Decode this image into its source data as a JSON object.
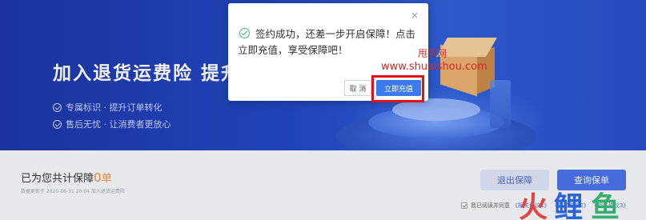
{
  "banner": {
    "title": "加入退货运费险 提升店",
    "features": [
      "专属标识 · 提升订单转化",
      "售后无忧 · 让消费者更放心"
    ]
  },
  "summary": {
    "prefix": "已为您共计保障",
    "count": "0",
    "unit": "单",
    "subtext": "数据更新于 2020-06-31 20:04 加入退货运费险"
  },
  "actions": {
    "exit_label": "退出保障",
    "query_label": "查询保单"
  },
  "agreement": {
    "label": "我已阅读并同意",
    "links": [
      "《相关协议1》",
      "《相关协议2》",
      "《相关协议3》"
    ]
  },
  "dialog": {
    "close_glyph": "×",
    "message": "签约成功，还差一步开启保障！点击立即充值，享受保障吧！",
    "cancel_label": "取 消",
    "recharge_label": "立即充值"
  },
  "watermark": {
    "site_name": "甩手网",
    "site_url": "www.shuaishou.com",
    "logo_chars": [
      "火",
      "鲤",
      "鱼"
    ]
  },
  "colors": {
    "banner_blue": "#2448c4",
    "accent_orange": "#f08c3a",
    "primary_blue": "#3b7af0",
    "highlight_red": "#e3121a",
    "success_green": "#3cb878"
  }
}
